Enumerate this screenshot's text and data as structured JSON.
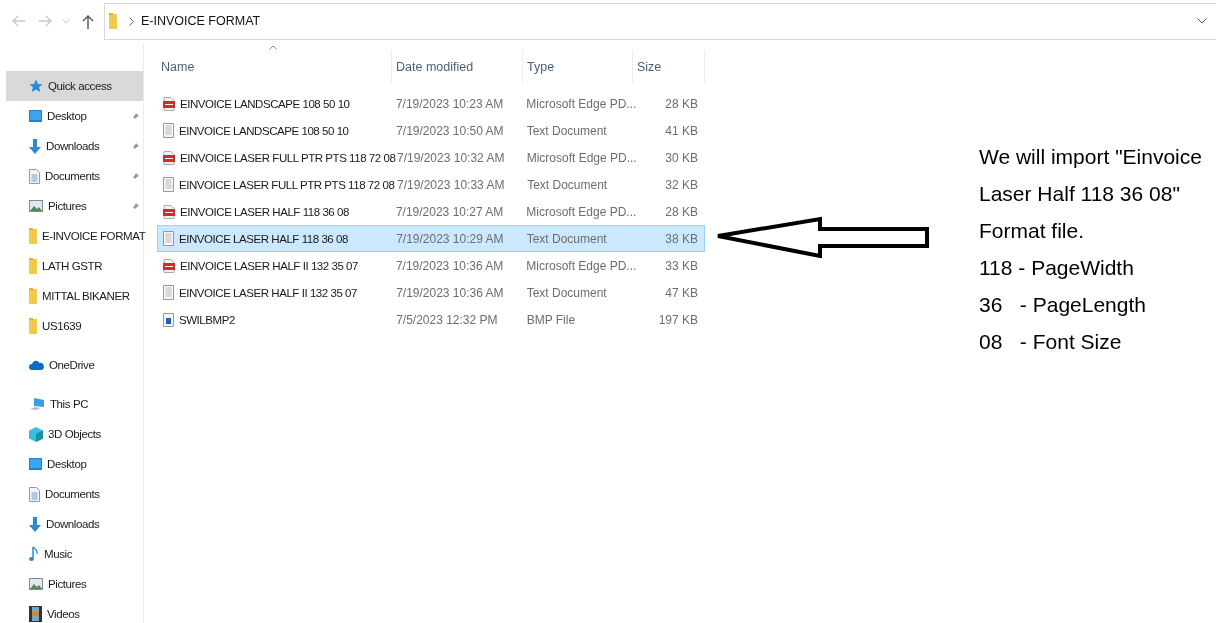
{
  "address_bar": {
    "path": "E-INVOICE FORMAT"
  },
  "sidebar": {
    "sections": [
      {
        "label": "Quick access",
        "kind": "star",
        "selected": true,
        "children": [
          {
            "label": "Desktop",
            "kind": "desktop",
            "pinned": true
          },
          {
            "label": "Downloads",
            "kind": "download",
            "pinned": true
          },
          {
            "label": "Documents",
            "kind": "document",
            "pinned": true
          },
          {
            "label": "Pictures",
            "kind": "picture",
            "pinned": true
          },
          {
            "label": "E-INVOICE FORMAT",
            "kind": "folder",
            "pinned": false
          },
          {
            "label": "LATH GSTR",
            "kind": "folder",
            "pinned": false
          },
          {
            "label": "MITTAL BIKANER",
            "kind": "folder",
            "pinned": false
          },
          {
            "label": "US1639",
            "kind": "folder",
            "pinned": false
          }
        ]
      },
      {
        "label": "OneDrive",
        "kind": "cloud",
        "selected": false
      },
      {
        "label": "This PC",
        "kind": "pc",
        "selected": false,
        "children": [
          {
            "label": "3D Objects",
            "kind": "cube",
            "pinned": false
          },
          {
            "label": "Desktop",
            "kind": "desktop",
            "pinned": false
          },
          {
            "label": "Documents",
            "kind": "document",
            "pinned": false
          },
          {
            "label": "Downloads",
            "kind": "download",
            "pinned": false
          },
          {
            "label": "Music",
            "kind": "music",
            "pinned": false
          },
          {
            "label": "Pictures",
            "kind": "picture",
            "pinned": false
          },
          {
            "label": "Videos",
            "kind": "video",
            "pinned": false
          }
        ]
      }
    ]
  },
  "file_list": {
    "columns": [
      "Name",
      "Date modified",
      "Type",
      "Size"
    ],
    "rows": [
      {
        "name": "EINVOICE LANDSCAPE 108 50 10",
        "kind": "pdf",
        "date": "7/19/2023 10:23 AM",
        "type": "Microsoft Edge PD...",
        "size": "28 KB",
        "selected": false
      },
      {
        "name": "EINVOICE LANDSCAPE 108 50 10",
        "kind": "txt",
        "date": "7/19/2023 10:50 AM",
        "type": "Text Document",
        "size": "41 KB",
        "selected": false
      },
      {
        "name": "EINVOICE LASER FULL PTR PTS 118 72 08",
        "kind": "pdf",
        "date": "7/19/2023 10:32 AM",
        "type": "Microsoft Edge PD...",
        "size": "30 KB",
        "selected": false
      },
      {
        "name": "EINVOICE LASER FULL PTR PTS 118 72 08",
        "kind": "txt",
        "date": "7/19/2023 10:33 AM",
        "type": "Text Document",
        "size": "32 KB",
        "selected": false
      },
      {
        "name": "EINVOICE LASER HALF 118 36 08",
        "kind": "pdf",
        "date": "7/19/2023 10:27 AM",
        "type": "Microsoft Edge PD...",
        "size": "28 KB",
        "selected": false
      },
      {
        "name": "EINVOICE LASER HALF 118 36 08",
        "kind": "txt",
        "date": "7/19/2023 10:29 AM",
        "type": "Text Document",
        "size": "38 KB",
        "selected": true
      },
      {
        "name": "EINVOICE LASER HALF II 132 35 07",
        "kind": "pdf",
        "date": "7/19/2023 10:36 AM",
        "type": "Microsoft Edge PD...",
        "size": "33 KB",
        "selected": false
      },
      {
        "name": "EINVOICE LASER HALF II 132 35 07",
        "kind": "txt",
        "date": "7/19/2023 10:36 AM",
        "type": "Text Document",
        "size": "47 KB",
        "selected": false
      },
      {
        "name": "SWILBMP2",
        "kind": "bmp",
        "date": "7/5/2023 12:32 PM",
        "type": "BMP File",
        "size": "197 KB",
        "selected": false
      }
    ]
  },
  "annotation": {
    "lines": [
      "We will import \"Einvoice",
      "Laser Half 118 36 08\"",
      "Format file.",
      "118 - PageWidth",
      "36   - PageLength",
      "08   - Font Size"
    ]
  }
}
